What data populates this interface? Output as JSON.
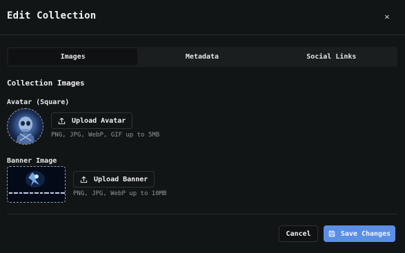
{
  "dialog": {
    "title": "Edit Collection",
    "close_label": "✕"
  },
  "tabs": [
    {
      "label": "Images",
      "active": true
    },
    {
      "label": "Metadata",
      "active": false
    },
    {
      "label": "Social Links",
      "active": false
    }
  ],
  "images": {
    "section_title": "Collection Images",
    "avatar": {
      "label": "Avatar (Square)",
      "button_label": "Upload Avatar",
      "hint": "PNG, JPG, WebP, GIF up to 5MB"
    },
    "banner": {
      "label": "Banner Image",
      "button_label": "Upload Banner",
      "hint": "PNG, JPG, WebP up to 10MB"
    }
  },
  "footer": {
    "cancel_label": "Cancel",
    "save_label": "Save Changes"
  },
  "colors": {
    "background": "#121516",
    "accent": "#5b8fe6",
    "border": "#2d3234"
  },
  "icons": {
    "close": "close-icon",
    "upload": "upload-icon",
    "save": "save-icon"
  }
}
